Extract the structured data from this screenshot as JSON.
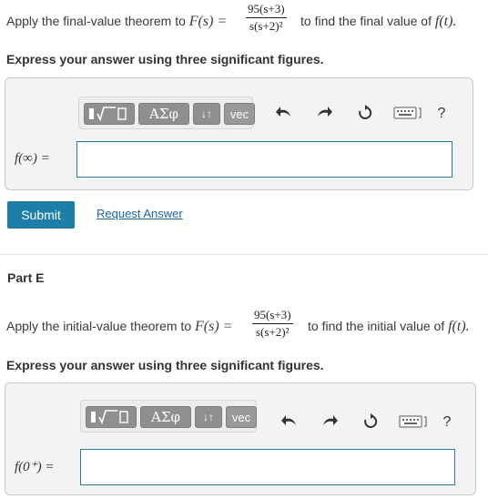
{
  "part_d": {
    "q_prefix": "Apply the final-value theorem to",
    "q_func": "F(s) =",
    "q_num": "95(s+3)",
    "q_den": "s(s+2)²",
    "q_suffix": "to find the final value of",
    "q_target": "f(t).",
    "instruction": "Express your answer using three significant figures.",
    "answer_label": "f(∞) =",
    "answer_value": "",
    "submit_label": "Submit",
    "request_label": "Request Answer"
  },
  "part_e": {
    "title": "Part E",
    "q_prefix": "Apply the initial-value theorem to",
    "q_func": "F(s) =",
    "q_num": "95(s+3)",
    "q_den": "s(s+2)²",
    "q_suffix": "to find the initial value of",
    "q_target": "f(t).",
    "instruction": "Express your answer using three significant figures.",
    "answer_label": "f(0⁺) =",
    "answer_value": ""
  },
  "toolbar": {
    "greek_label": "ΑΣφ",
    "arrows_label": "↓↑",
    "vec_label": "vec",
    "help_label": "?"
  },
  "colors": {
    "accent": "#1d7fa8",
    "toolbar_button": "#8f8f8f",
    "input_border": "#2a7a9a",
    "link": "#1a66a8"
  },
  "icons": [
    "templates-icon",
    "undo-icon",
    "redo-icon",
    "reset-icon",
    "keyboard-icon"
  ]
}
